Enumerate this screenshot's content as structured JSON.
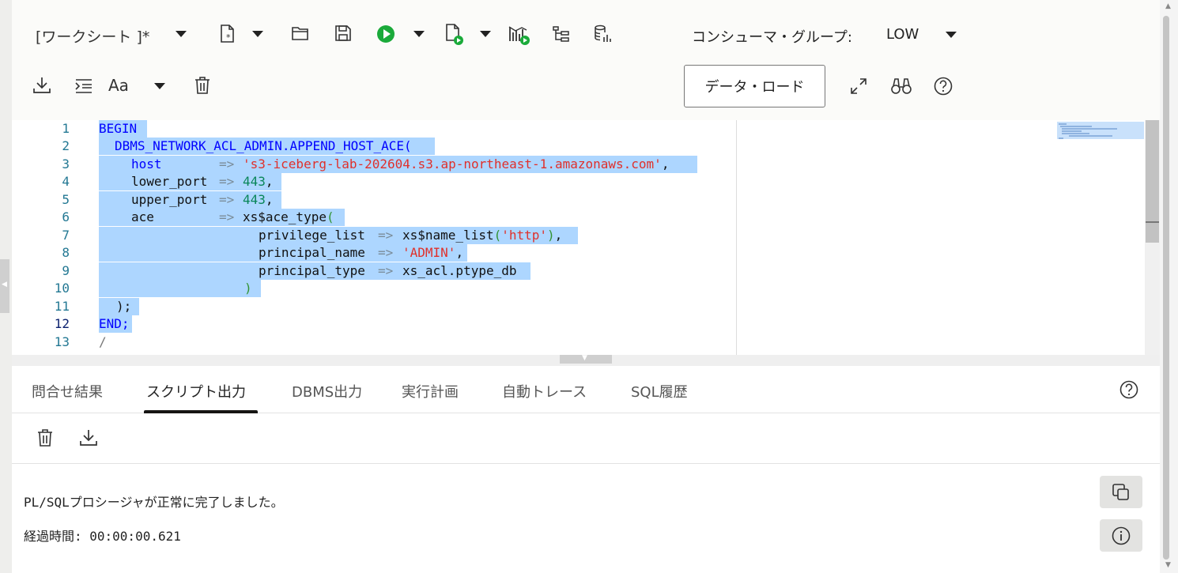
{
  "toolbar": {
    "worksheet_label": "[ワークシート ]*",
    "consumer_group_label": "コンシューマ・グループ:",
    "consumer_group_value": "LOW",
    "data_load_label": "データ・ロード",
    "font_size_label": "Aa"
  },
  "editor": {
    "line_numbers": [
      "1",
      "2",
      "3",
      "4",
      "5",
      "6",
      "7",
      "8",
      "9",
      "10",
      "11",
      "12",
      "13"
    ],
    "current_line": "12"
  },
  "tabs": [
    {
      "label": "問合せ結果"
    },
    {
      "label": "スクリプト出力"
    },
    {
      "label": "DBMS出力"
    },
    {
      "label": "実行計画"
    },
    {
      "label": "自動トレース"
    },
    {
      "label": "SQL履歴"
    }
  ],
  "active_tab": "スクリプト出力",
  "output": {
    "line1": "PL/SQLプロシージャが正常に完了しました。",
    "line2": "経過時間: 00:00:00.621"
  },
  "code": {
    "l1": "BEGIN",
    "l2": "DBMS_NETWORK_ACL_ADMIN.APPEND_HOST_ACE(",
    "l3_name": "host",
    "l3_str": "'s3-iceberg-lab-202604.s3.ap-northeast-1.amazonaws.com'",
    "l4_name": "lower_port",
    "l4_num": "443",
    "l5_name": "upper_port",
    "l5_num": "443",
    "l6_name": "ace",
    "l6_fn": "xs$ace_type",
    "l7_name": "privilege_list",
    "l7_fn": "xs$name_list",
    "l7_str": "'http'",
    "l8_name": "principal_name",
    "l8_str": "'ADMIN'",
    "l9_name": "principal_type",
    "l9_val": "xs_acl.ptype_db",
    "l11": ");",
    "l12": "END;",
    "l13": "/"
  },
  "colors": {
    "selection": "#add6ff",
    "keyword": "#0000ff",
    "string": "#e0302a",
    "number": "#098658",
    "run_green": "#1aaa3a"
  },
  "icons": [
    "new-worksheet-icon",
    "open-folder-icon",
    "save-icon",
    "run-icon",
    "run-script-icon",
    "explain-plan-icon",
    "autotrace-icon",
    "database-icon",
    "download-icon",
    "format-icon",
    "font-size-icon",
    "trash-icon",
    "expand-icon",
    "binoculars-icon",
    "help-icon",
    "copy-icon",
    "info-icon"
  ]
}
